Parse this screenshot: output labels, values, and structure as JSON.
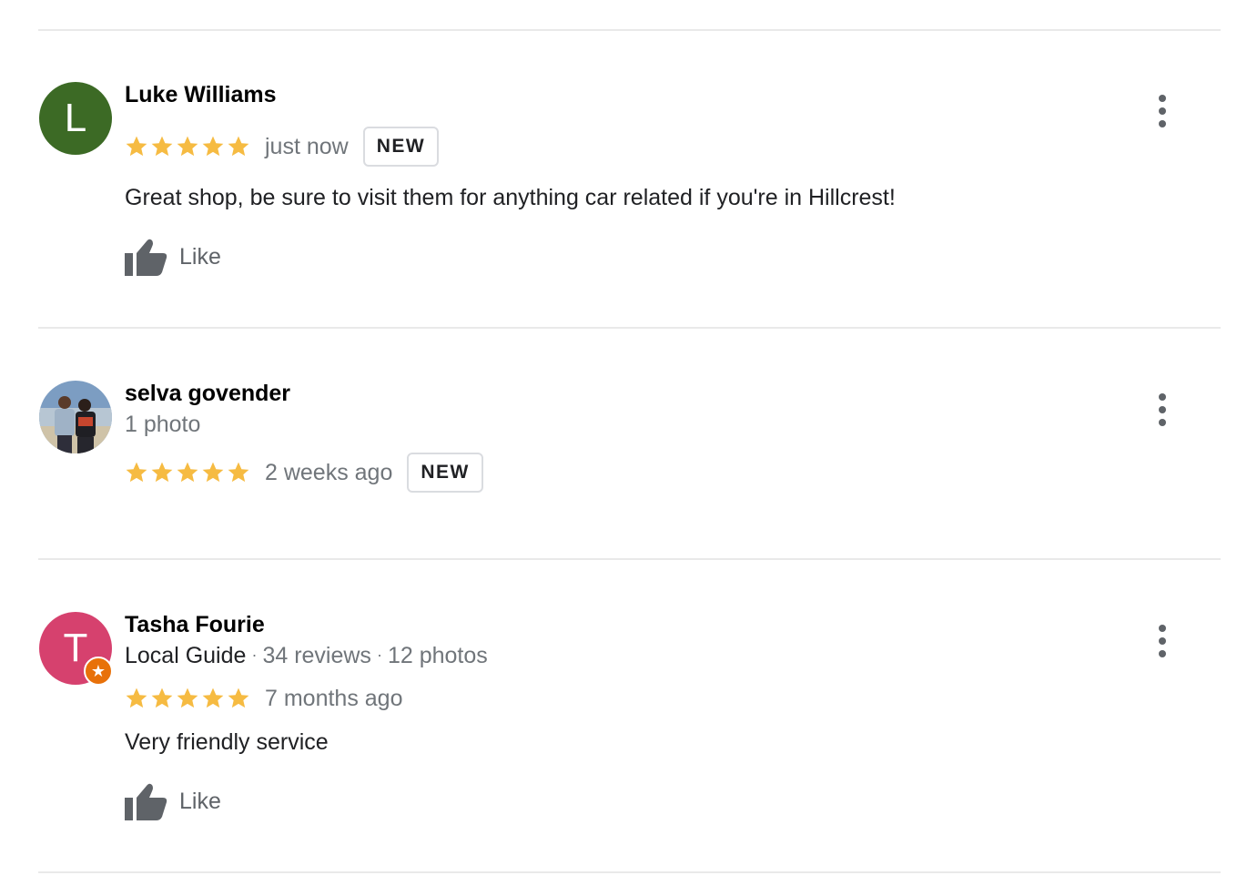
{
  "colors": {
    "star": "#f6bb42",
    "avatar_luke": "#3c6a25",
    "avatar_tasha": "#d6416e",
    "local_guide_badge": "#e8710a",
    "secondary_text": "#70757a"
  },
  "reviews": [
    {
      "avatar_letter": "L",
      "name": "Luke Williams",
      "rating": 5,
      "time": "just now",
      "badge": "NEW",
      "text": "Great shop, be sure to visit them for anything car related if you're in Hillcrest!",
      "like_label": "Like"
    },
    {
      "name": "selva govender",
      "subtitle": "1 photo",
      "rating": 5,
      "time": "2 weeks ago",
      "badge": "NEW"
    },
    {
      "avatar_letter": "T",
      "name": "Tasha Fourie",
      "guide_label": "Local Guide",
      "reviews_count": "34 reviews",
      "photos_count": "12 photos",
      "rating": 5,
      "time": "7 months ago",
      "text": "Very friendly service",
      "like_label": "Like"
    }
  ]
}
